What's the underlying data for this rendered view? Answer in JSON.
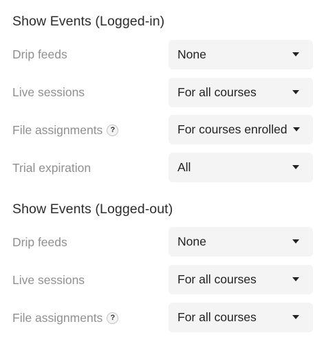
{
  "logged_in": {
    "title": "Show Events (Logged-in)",
    "rows": [
      {
        "label": "Drip feeds",
        "value": "None",
        "has_help": false
      },
      {
        "label": "Live sessions",
        "value": "For all courses",
        "has_help": false
      },
      {
        "label": "File assignments",
        "value": "For courses enrolled",
        "has_help": true
      },
      {
        "label": "Trial expiration",
        "value": "All",
        "has_help": false
      }
    ]
  },
  "logged_out": {
    "title": "Show Events (Logged-out)",
    "rows": [
      {
        "label": "Drip feeds",
        "value": "None",
        "has_help": false
      },
      {
        "label": "Live sessions",
        "value": "For all courses",
        "has_help": false
      },
      {
        "label": "File assignments",
        "value": "For all courses",
        "has_help": true
      }
    ]
  },
  "help_icon_glyph": "?",
  "icons": {
    "help": "question-circle-icon",
    "dropdown": "caret-down-icon"
  },
  "colors": {
    "title": "#2b2b2b",
    "label": "#8f8f8f",
    "select_bg": "#f4f4f4",
    "value": "#222222"
  }
}
